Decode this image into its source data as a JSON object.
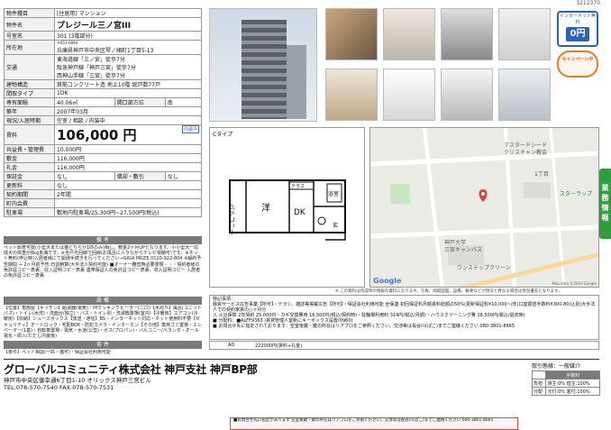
{
  "doc_no": "3212370",
  "specs": {
    "rows": [
      {
        "k": "物件種目",
        "v": "[住居用] マンション"
      },
      {
        "k": "物件名",
        "v": "プレジール三ノ宮III"
      },
      {
        "k": "号室名",
        "v": "301 (3階部分)"
      },
      {
        "k": "所在地",
        "v_small": "〒651-0094",
        "v": "兵庫県神戸市中央区琴ノ緒町1丁目5-13"
      },
      {
        "k": "交通",
        "lines": [
          "東海道線「三ノ宮」徒歩7分",
          "阪急神戸線「神戸三宮」徒歩7分",
          "西神山手線「三宮」徒歩7分"
        ]
      },
      {
        "k": "建物構造",
        "v": "鉄筋コンクリート造 地上10階 総戸数77戸"
      },
      {
        "k": "間取タイプ",
        "v": "1DK"
      },
      {
        "k": "専有面積",
        "v": "40.06㎡",
        "k2": "開口部方位",
        "v2": "南"
      },
      {
        "k": "築年",
        "v": "2007年03月"
      },
      {
        "k": "現況/入居時期",
        "v": "空室 / 相談 / 内装中"
      },
      {
        "k": "賃料",
        "v": "106,000 円",
        "badge": "内装中"
      },
      {
        "k": "共益費・管理費",
        "v": "10,000円"
      },
      {
        "k": "敷金",
        "v": "116,000円"
      },
      {
        "k": "礼金",
        "v": "116,000円"
      },
      {
        "k": "保証金",
        "v": "なし",
        "k2": "償却・敷引",
        "v2": "なし"
      },
      {
        "k": "更新料",
        "v": "なし"
      },
      {
        "k": "契約期間",
        "v": "2年間"
      },
      {
        "k": "町内会費",
        "v": ""
      },
      {
        "k": "駐車場",
        "v": "敷地内駐車場/25,300円~27,500円(税込)"
      }
    ]
  },
  "sections": {
    "bikou": "備 考",
    "setsubi": "設 備",
    "jouken": "条 件"
  },
  "bikou_text": "ペット飼育可能(小型犬または猫どちらか1匹のみ)相し、敷金2ヶ月UPとなります。小小型犬一応成犬の体重が8kg未満です。※全戸光回線で回線(お風呂に入りながらテレビ視聴可)です。※ネット無料(申込時)入居者様にて開通手続きを行ってください→GIGA PRIZE 0120-922-804 ※解約予告期間 → 2ヶ月前予告:日割精算(大手法人契約可能) ■オーナー審査時必要書類・・・契約者様の免許証コピー表裏、収入証明コピー表裏 連帯保証人の免許証コピー表裏、収入証明コピー 入居者の免許証コピー表裏",
  "setsubi_text": "【位置】角部屋【キッチン】給湯器(電気)・IHクッキングヒーター(二口)【水周り】風呂(ユニットバス)・トイレ(水洗)・洗面台(独立)・バス・トイレ別・洗濯機置場(室内)【冷暖房】エアコン(冷暖房)【収納】シューズボックス【放送・通信】BS・インターネット対応・ネット使用料不要【セキュリティ】オートロック・宅配BOX・防犯カメラ・インターホン【その他】専用ゴミ置場・エレベーター(1基)・自転車置場・電気・水道(公営)・ガス(プロパン)・バルコニー/ベランダ・オール電化・即入(ただし内装後)",
  "jouken_text": "【条件】ペット相談(一匹・猫可)・保証会社利用可能",
  "floorplan": {
    "label": "Cタイプ",
    "rooms": {
      "balcony": "バルコニー",
      "main": "洋",
      "dk": "DK",
      "terrace": "テラス",
      "bath": "浴室",
      "shoes": "玄"
    }
  },
  "map": {
    "labels": [
      "マスタードシード",
      "クリスチャン教会",
      "1丁目",
      "スターラップ",
      "神戸大学",
      "三宮キャンパス",
      "ワンステップクリーン"
    ],
    "logo": "Google",
    "credit": "Map data ©2019 Google"
  },
  "badges": {
    "internet_top": "インターネット無料",
    "internet_zero": "0円",
    "campaign": "キャンペーン中"
  },
  "disclaimer": "※ この資料は作成時の情報の資料になります。写真、間取図面、設備、概要などが現況と異なる場合は現況優先となります。",
  "remarks": {
    "title": "特記事項：",
    "lines": [
      "融資サービス広告事業【所可】・テラシ、雑誌等掲載広告【所可】・保証会社利用可能 全保連 初回保証料月額賃料総額の50%(更新保証料¥10,000~/年)口座振替手数料¥300-80(込別)大手法人での契約家賃の○ヶ月分",
      "入 火災保険 2年契約 25,000円・カギ交換費用 16,500円(税込/契約時)・駐輪場利用料 314円(税込/月額)・ハウスクリーニング費 38,500円(税込/退去時)",
      "■ 分配料：■ALFF9363 |賃貸管理人室新にキーボックス設置(0960)",
      "■ お問合せ先に指定されております：空室後鍵・鍵の所在はリアプロをご参照ください。交渉等は長谷川(ぱこ)までご連絡ください 080-3801-8665"
    ]
  },
  "fee": {
    "ad_label": "AD",
    "ad_value": "222000円(賃料+礼金)"
  },
  "side_tab": "業務情報",
  "company": {
    "name": "グローバルコミュニティ株式会社 神戸支社 神戸BP部",
    "address": "神戸市中央区御幸通6丁目1-10 オリックス神戸三宮ビル",
    "tel": "TEL:078-570-7540 FAX:078-570-7531"
  },
  "torihiki": {
    "title": "取引態様：一般媒介",
    "header": "手数料",
    "rows": [
      {
        "k": "負担",
        "v": "貸主:0% 借主:100%"
      },
      {
        "k": "分配",
        "v": "元付:0% 客付:100%"
      }
    ]
  },
  "bottom_note": "■お問合せ先に指定があります 空室後鍵・鍵の所在はリアプロをご参照ください。交渉等は長谷川(ぱこ)までご連絡ください 080-3801-8665"
}
